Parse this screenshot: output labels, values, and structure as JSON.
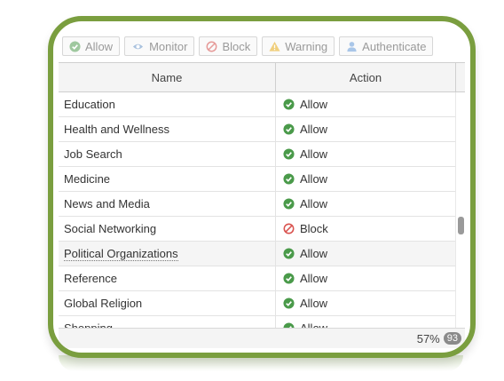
{
  "toolbar": {
    "buttons": [
      {
        "label": "Allow",
        "icon": "check-circle-icon"
      },
      {
        "label": "Monitor",
        "icon": "eye-icon"
      },
      {
        "label": "Block",
        "icon": "block-icon"
      },
      {
        "label": "Warning",
        "icon": "warning-icon"
      },
      {
        "label": "Authenticate",
        "icon": "user-icon"
      }
    ]
  },
  "columns": {
    "name": "Name",
    "action": "Action"
  },
  "rows": [
    {
      "name": "Education",
      "action": "Allow"
    },
    {
      "name": "Health and Wellness",
      "action": "Allow"
    },
    {
      "name": "Job Search",
      "action": "Allow"
    },
    {
      "name": "Medicine",
      "action": "Allow"
    },
    {
      "name": "News and Media",
      "action": "Allow"
    },
    {
      "name": "Social Networking",
      "action": "Block"
    },
    {
      "name": "Political Organizations",
      "action": "Allow"
    },
    {
      "name": "Reference",
      "action": "Allow"
    },
    {
      "name": "Global Religion",
      "action": "Allow"
    },
    {
      "name": "Shopping",
      "action": "Allow"
    }
  ],
  "footer": {
    "percent": "57%",
    "count": "93"
  },
  "colors": {
    "frame": "#7a9e3f",
    "allow": "#4a9a4a",
    "block": "#d9534f",
    "warning": "#e8b23a",
    "monitor": "#6c93c2",
    "authenticate": "#8ab0dd"
  }
}
